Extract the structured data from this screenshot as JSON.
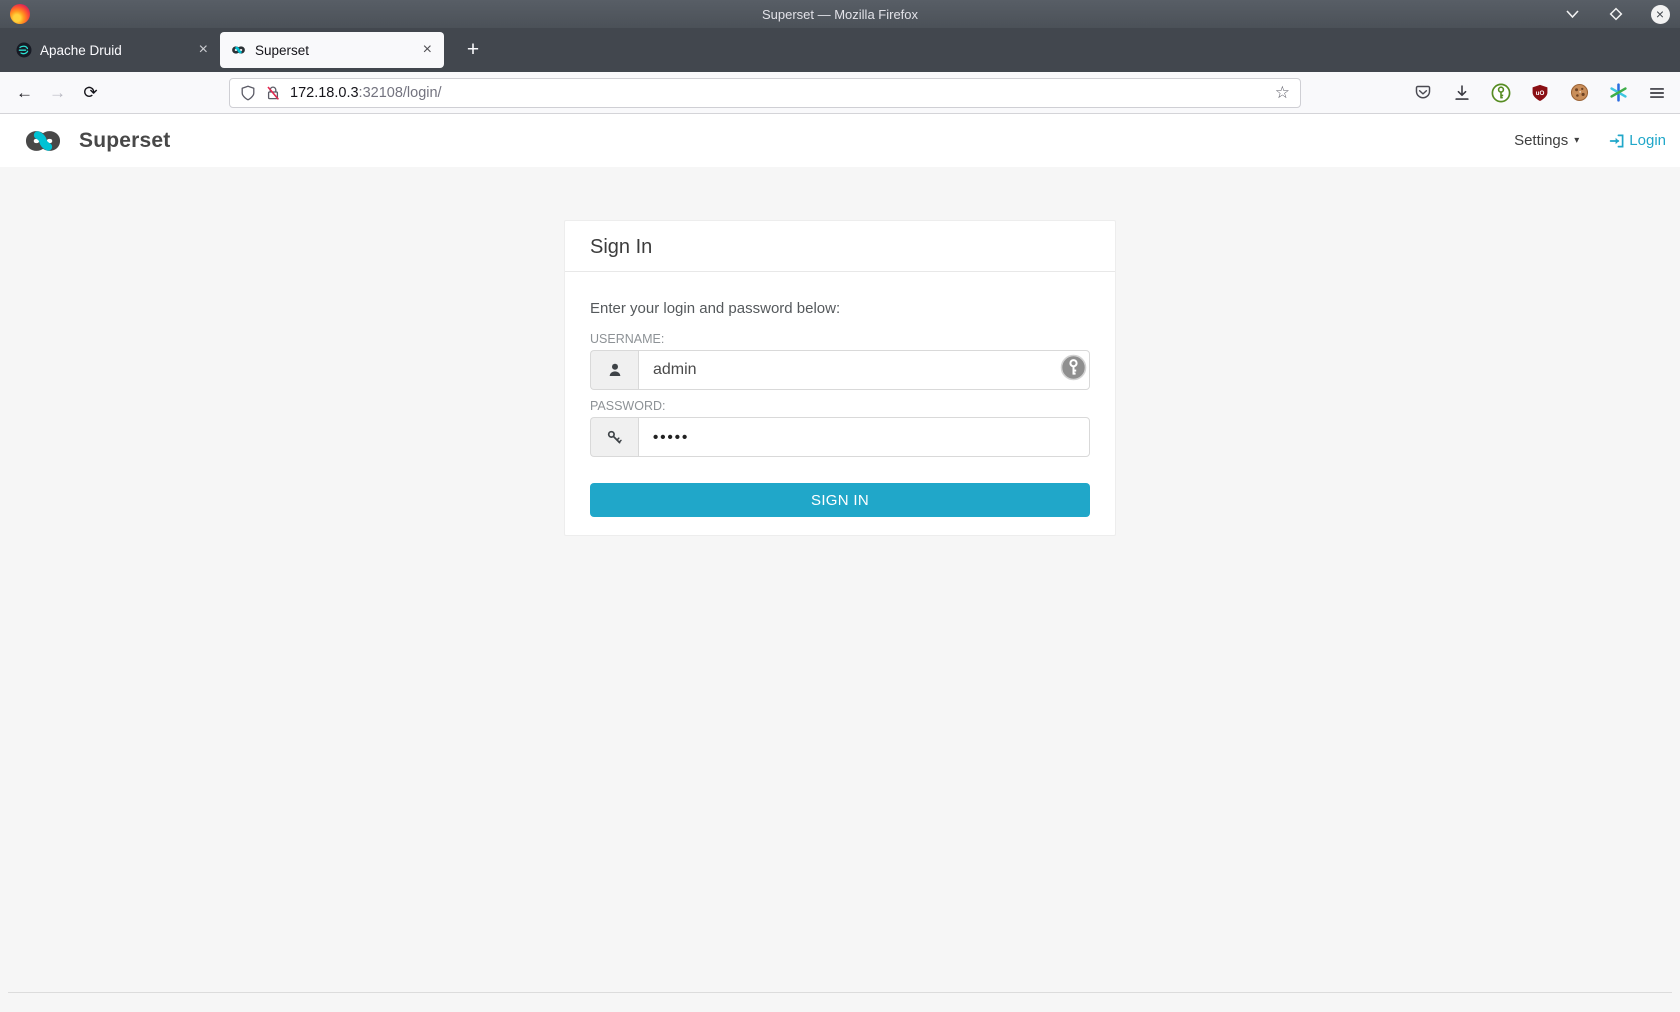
{
  "colors": {
    "accent": "#20a7c9",
    "brand_dark": "#484848",
    "tabbar_bg": "#42474e",
    "toolbar_bg": "#f9f9fb",
    "page_bg": "#f6f6f6",
    "ublock_red": "#8a0f14",
    "keepassxc_green": "#568c22",
    "insecure_strike": "#e22850"
  },
  "browser": {
    "window_title": "Superset — Mozilla Firefox",
    "tabs": [
      {
        "label": "Apache Druid",
        "favicon": "druid-icon",
        "active": false
      },
      {
        "label": "Superset",
        "favicon": "superset-infinity-icon",
        "active": true
      }
    ],
    "close_tab_glyph": "×",
    "new_tab_glyph": "+",
    "toolbar": {
      "back_glyph": "←",
      "forward_glyph": "→",
      "reload_glyph": "⟳",
      "star_glyph": "☆",
      "urlbar": {
        "host": "172.18.0.3",
        "rest": ":32108/login/"
      }
    },
    "extensions": {
      "ublock_label": "uO"
    }
  },
  "app": {
    "brand": "Superset",
    "nav": {
      "settings_label": "Settings",
      "settings_caret": "▾",
      "login_label": "Login"
    },
    "login": {
      "title": "Sign In",
      "instruction": "Enter your login and password below:",
      "username_label": "USERNAME:",
      "username_value": "admin",
      "password_label": "PASSWORD:",
      "password_masked": "•••••",
      "submit_label": "SIGN IN"
    }
  }
}
